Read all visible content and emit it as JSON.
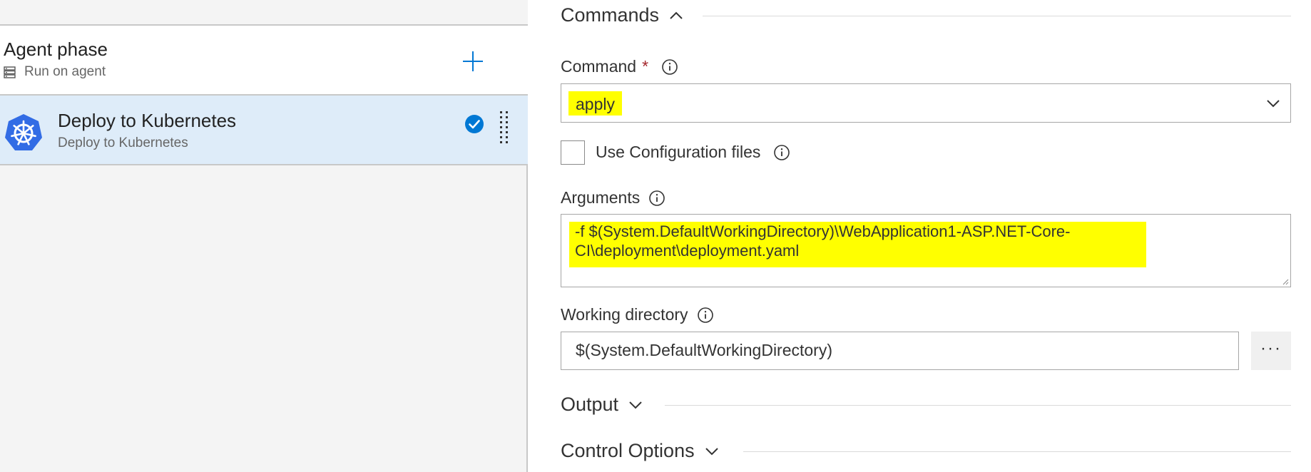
{
  "left_panel": {
    "phase": {
      "title": "Agent phase",
      "subtitle": "Run on agent",
      "icon": "server-icon"
    },
    "task": {
      "title": "Deploy to Kubernetes",
      "subtitle": "Deploy to Kubernetes",
      "icon": "kubernetes-icon",
      "status": "checked"
    }
  },
  "right_panel": {
    "commands_section": {
      "label": "Commands",
      "expanded": true
    },
    "command_field": {
      "label": "Command",
      "required_mark": "*",
      "value": "apply"
    },
    "use_config_files": {
      "label": "Use Configuration files",
      "checked": false
    },
    "arguments_field": {
      "label": "Arguments",
      "value": "-f $(System.DefaultWorkingDirectory)\\WebApplication1-ASP.NET-Core-\nCI\\deployment\\deployment.yaml"
    },
    "working_directory": {
      "label": "Working directory",
      "value": "$(System.DefaultWorkingDirectory)",
      "browse_label": "···"
    },
    "output_section": {
      "label": "Output",
      "expanded": false
    },
    "control_options_section": {
      "label": "Control Options",
      "expanded": false
    }
  },
  "colors": {
    "highlight": "#ffff00",
    "selected_row": "#deecf9",
    "accent_blue": "#0078d4",
    "kubernetes_blue": "#326ce5",
    "required_red": "#a4262c"
  }
}
